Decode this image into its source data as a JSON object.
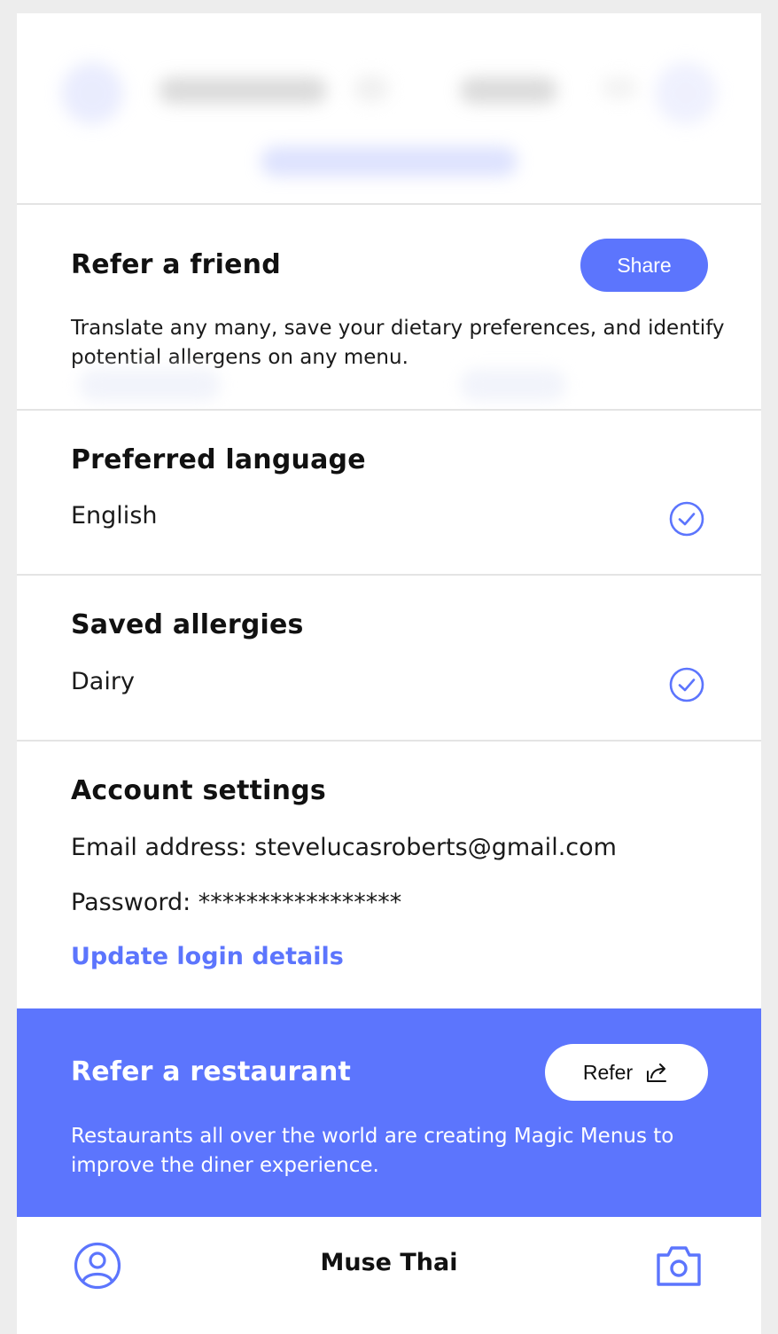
{
  "refer_friend": {
    "title": "Refer a friend",
    "share_label": "Share",
    "description": "Translate any many, save your dietary preferences, and identify potential allergens on any menu."
  },
  "language": {
    "title": "Preferred language",
    "value": "English"
  },
  "allergies": {
    "title": "Saved allergies",
    "value": "Dairy"
  },
  "account": {
    "title": "Account settings",
    "email_line": "Email address: stevelucasroberts@gmail.com",
    "password_line": "Password: *****************",
    "update_link": "Update login details"
  },
  "refer_restaurant": {
    "title": "Refer a restaurant",
    "button_label": "Refer",
    "description": "Restaurants all over the world are creating Magic Menus to improve the diner experience."
  },
  "bottom_bar": {
    "title": "Muse Thai",
    "left_icon": "profile-icon",
    "right_icon": "camera-icon"
  },
  "colors": {
    "accent": "#5c75fd",
    "background": "#ededed",
    "divider": "#e4e4e4"
  }
}
